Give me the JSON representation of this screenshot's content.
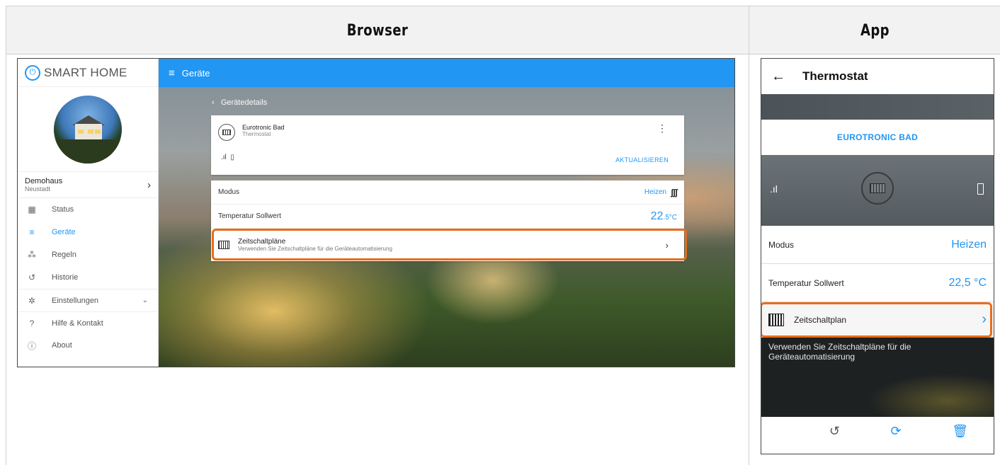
{
  "headers": {
    "browser": "Browser",
    "app": "App"
  },
  "browser": {
    "logo": {
      "icon": "power-icon",
      "text": "SMART HOME"
    },
    "location": {
      "name": "Demohaus",
      "city": "Neustadt"
    },
    "nav": [
      {
        "label": "Status",
        "icon": "grid-icon"
      },
      {
        "label": "Geräte",
        "icon": "list-icon",
        "active": true
      },
      {
        "label": "Regeln",
        "icon": "wand-icon"
      },
      {
        "label": "Historie",
        "icon": "history-icon"
      },
      {
        "label": "Einstellungen",
        "icon": "gear-icon"
      },
      {
        "label": "Hilfe & Kontakt",
        "icon": "help-icon"
      },
      {
        "label": "About",
        "icon": "info-icon"
      }
    ],
    "topbar_title": "Geräte",
    "back_label": "Gerätedetails",
    "device": {
      "name": "Eurotronic Bad",
      "type": "Thermostat",
      "refresh": "AKTUALISIEREN"
    },
    "mode": {
      "label": "Modus",
      "value": "Heizen"
    },
    "temp": {
      "label": "Temperatur Sollwert",
      "value": "22",
      "decimal": ".5",
      "unit": "°C"
    },
    "schedule": {
      "title": "Zeitschaltpläne",
      "subtitle": "Verwenden Sie Zeitschaltpläne für die Geräteautomatisierung"
    }
  },
  "app": {
    "title": "Thermostat",
    "device_name": "EUROTRONIC BAD",
    "mode": {
      "label": "Modus",
      "value": "Heizen"
    },
    "temp": {
      "label": "Temperatur Sollwert",
      "value": "22,5 °C"
    },
    "schedule": {
      "label": "Zeitschaltplan"
    },
    "info": "Verwenden Sie Zeitschaltpläne für die Geräteautomatisierung"
  },
  "colors": {
    "accent": "#2196f3",
    "highlight": "#e86d1a"
  }
}
